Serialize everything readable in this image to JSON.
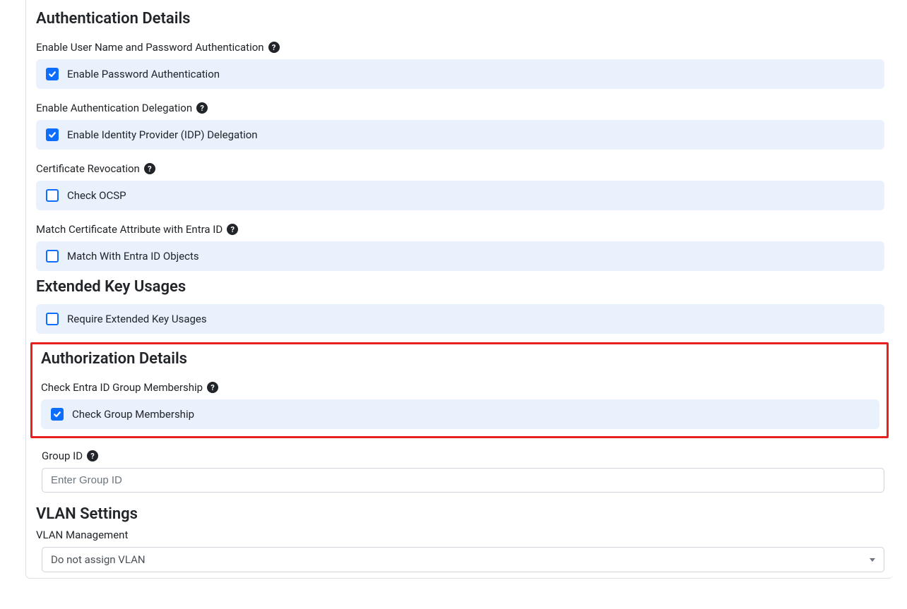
{
  "sections": {
    "auth_details": {
      "title": "Authentication Details",
      "username_password": {
        "label": "Enable User Name and Password Authentication",
        "checkbox_label": "Enable Password Authentication",
        "checked": true
      },
      "delegation": {
        "label": "Enable Authentication Delegation",
        "checkbox_label": "Enable Identity Provider (IDP) Delegation",
        "checked": true
      },
      "revocation": {
        "label": "Certificate Revocation",
        "checkbox_label": "Check OCSP",
        "checked": false
      },
      "match_cert": {
        "label": "Match Certificate Attribute with Entra ID",
        "checkbox_label": "Match With Entra ID Objects",
        "checked": false
      }
    },
    "eku": {
      "title": "Extended Key Usages",
      "checkbox_label": "Require Extended Key Usages",
      "checked": false
    },
    "authz": {
      "title": "Authorization Details",
      "group_membership": {
        "label": "Check Entra ID Group Membership",
        "checkbox_label": "Check Group Membership",
        "checked": true
      },
      "group_id": {
        "label": "Group ID",
        "placeholder": "Enter Group ID",
        "value": ""
      }
    },
    "vlan": {
      "title": "VLAN Settings",
      "label": "VLAN Management",
      "selected": "Do not assign VLAN"
    }
  }
}
